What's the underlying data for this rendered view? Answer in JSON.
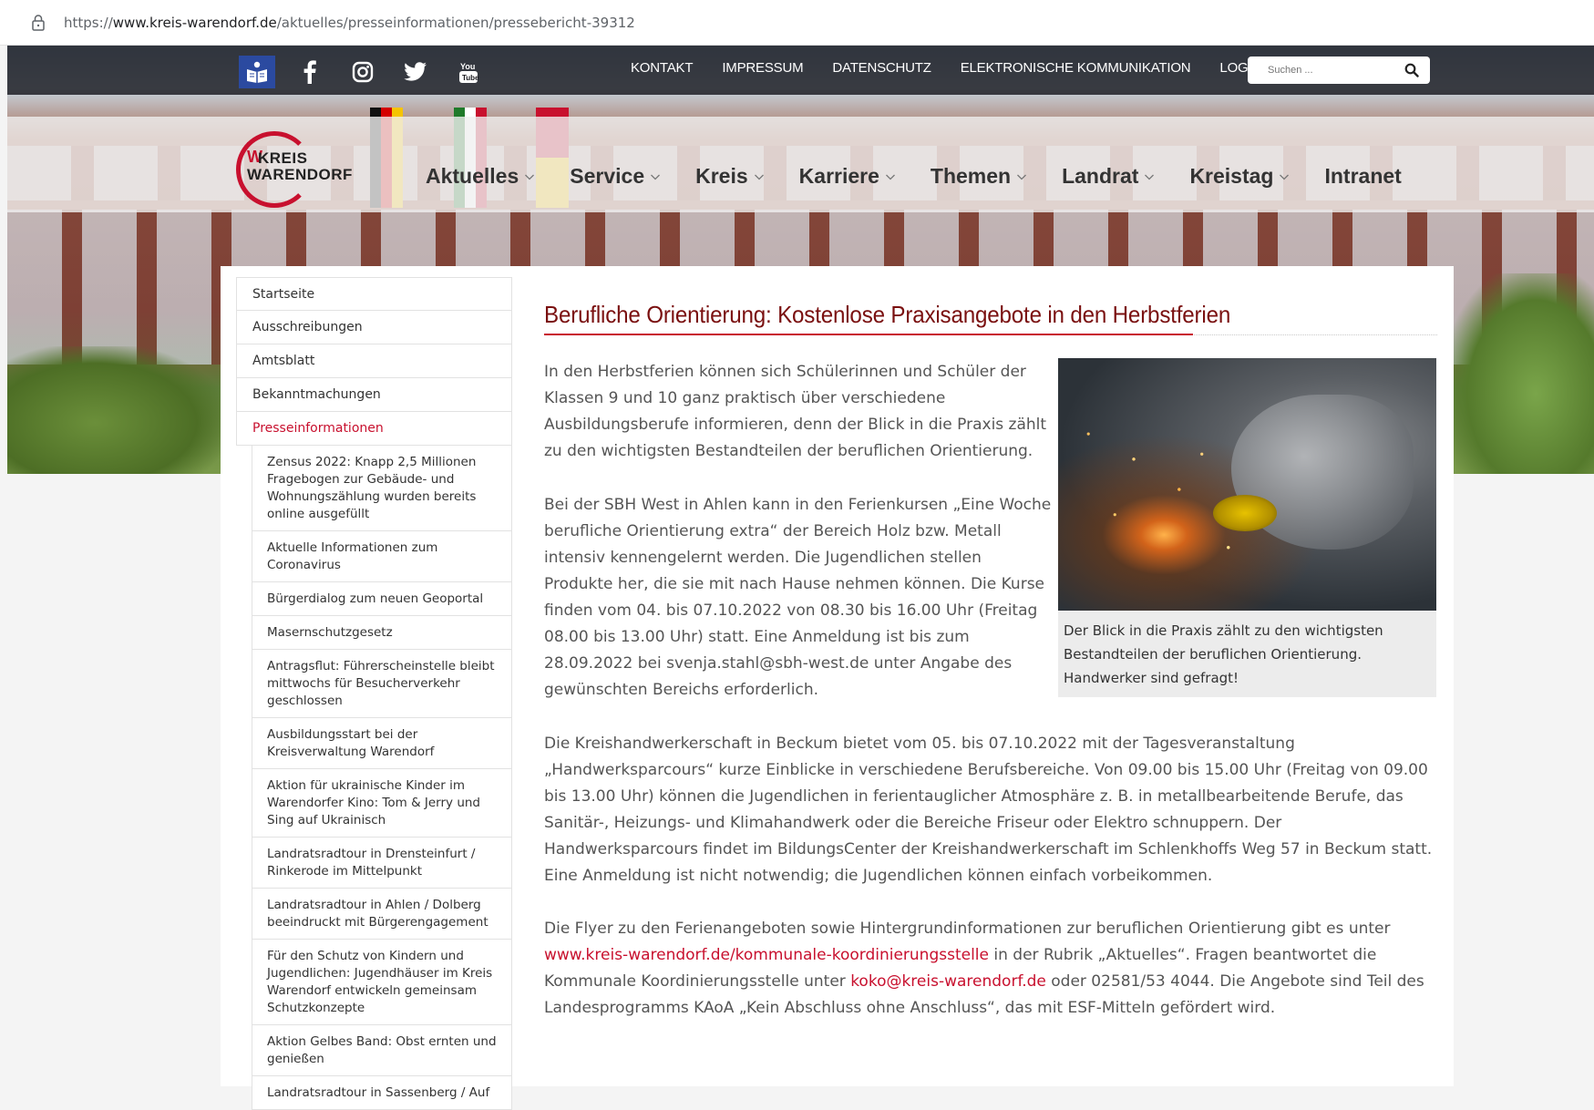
{
  "browser": {
    "url_scheme": "https://",
    "url_host": "www.kreis-warendorf.de",
    "url_path": "/aktuelles/presseinformationen/pressebericht-39312"
  },
  "topbar": {
    "links": [
      "KONTAKT",
      "IMPRESSUM",
      "DATENSCHUTZ",
      "ELEKTRONISCHE KOMMUNIKATION",
      "LOGIN"
    ],
    "search_placeholder": "Suchen ...",
    "social_icons": [
      "easy-language-book-icon",
      "facebook-icon",
      "instagram-icon",
      "twitter-icon",
      "youtube-icon"
    ]
  },
  "logo": {
    "line1": "KREIS",
    "line2": "WARENDORF"
  },
  "mainnav": {
    "items": [
      {
        "label": "Aktuelles",
        "dropdown": true
      },
      {
        "label": "Service",
        "dropdown": true
      },
      {
        "label": "Kreis",
        "dropdown": true
      },
      {
        "label": "Karriere",
        "dropdown": true
      },
      {
        "label": "Themen",
        "dropdown": true
      },
      {
        "label": "Landrat",
        "dropdown": true
      },
      {
        "label": "Kreistag",
        "dropdown": true
      },
      {
        "label": "Intranet",
        "dropdown": false
      }
    ]
  },
  "sidebar": {
    "items": [
      "Startseite",
      "Ausschreibungen",
      "Amtsblatt",
      "Bekanntmachungen",
      "Presseinformationen"
    ],
    "active_index": 4,
    "subitems": [
      "Zensus 2022: Knapp 2,5 Millionen Fragebogen zur Gebäude- und Wohnungszählung wurden bereits online ausgefüllt",
      "Aktuelle Informationen zum Coronavirus",
      "Bürgerdialog zum neuen Geoportal",
      "Masernschutzgesetz",
      "Antragsflut: Führerscheinstelle bleibt mittwochs für Besucherverkehr geschlossen",
      "Ausbildungsstart bei der Kreisverwaltung Warendorf",
      "Aktion für ukrainische Kinder im Warendorfer Kino: Tom & Jerry und Sing auf Ukrainisch",
      "Landratsradtour in Drensteinfurt / Rinkerode im Mittelpunkt",
      "Landratsradtour in Ahlen / Dolberg beeindruckt mit Bürgerengagement",
      "Für den Schutz von Kindern und Jugendlichen: Jugendhäuser im Kreis Warendorf entwickeln gemeinsam Schutzkonzepte",
      "Aktion Gelbes Band: Obst ernten und genießen",
      "Landratsradtour in Sassenberg / Auf"
    ]
  },
  "article": {
    "title": "Berufliche Orientierung: Kostenlose Praxisangebote in den Herbstferien",
    "p1": "In den Herbstferien können sich Schülerinnen und Schüler der Klassen 9 und 10 ganz praktisch über verschiedene Ausbildungsberufe informieren, denn der Blick in die Praxis zählt zu den wichtigsten Bestandteilen der beruflichen Orientierung.",
    "p2": "Bei der SBH West in Ahlen kann in den Ferienkursen „Eine Woche berufliche Orientierung extra“ der Bereich Holz bzw. Metall intensiv kennengelernt werden. Die Jugendlichen stellen Produkte her, die sie mit nach Hause nehmen können. Die Kurse finden vom 04. bis 07.10.2022 von 08.30 bis 16.00 Uhr (Freitag 08.00 bis 13.00 Uhr) statt. Eine Anmeldung ist bis zum 28.09.2022 bei svenja.stahl@sbh-west.de unter Angabe des gewünschten Bereichs erforderlich.",
    "p3": "Die Kreishandwerkerschaft in Beckum bietet vom 05. bis 07.10.2022 mit der Tagesveranstaltung „Handwerksparcours“ kurze Einblicke in verschiedene Berufsbereiche. Von 09.00 bis 15.00 Uhr (Freitag von 09.00 bis 13.00 Uhr) können die Jugendlichen in ferientauglicher Atmosphäre z. B. in metallbearbeitende Berufe, das Sanitär-, Heizungs- und Klimahandwerk oder die Bereiche Friseur oder Elektro schnuppern. Der Handwerksparcours findet im BildungsCenter der Kreishandwerkerschaft im Schlenkhoffs Weg 57 in Beckum statt. Eine Anmeldung ist nicht notwendig; die Jugendlichen können einfach vorbeikommen.",
    "p4_a": "Die Flyer zu den Ferienangeboten sowie Hintergrundinformationen zur beruflichen Orientierung gibt es unter ",
    "p4_link1": "www.kreis-warendorf.de/kommunale-koordinierungsstelle",
    "p4_b": " in der Rubrik „Aktuelles“. Fragen beantwortet die Kommunale Koordinierungsstelle unter ",
    "p4_link2": "koko@kreis-warendorf.de",
    "p4_c": " oder 02581/53 4044. Die Angebote sind Teil des Landesprogramms KAoA „Kein Abschluss ohne Anschluss“, das mit ESF-Mitteln gefördert wird.",
    "figure_caption": "Der Blick in die Praxis zählt zu den wichtigsten Bestandteilen der beruflichen Orientierung. Handwerker sind gefragt!"
  },
  "colors": {
    "accent_red": "#c8102e",
    "title_red": "#7a1010",
    "topbar_dark": "#19191e"
  }
}
